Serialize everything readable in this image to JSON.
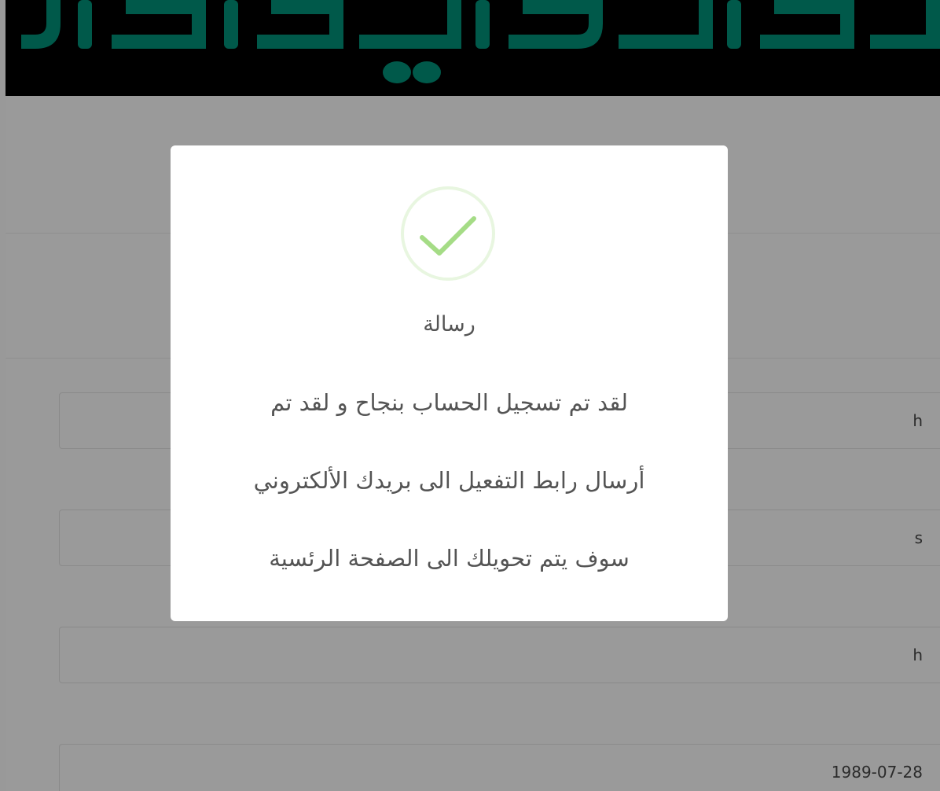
{
  "colors": {
    "overlay": "#999999",
    "header_bg": "#000000",
    "logo_teal": "#00594a",
    "modal_bg": "#ffffff",
    "text": "#545454",
    "success_green": "#a5dc86",
    "success_ring": "#e8f6e0"
  },
  "modal": {
    "icon": "success-check-icon",
    "title": "رسالة",
    "lines": [
      "لقد تم تسجيل الحساب بنجاح و لقد تم",
      "أرسال رابط التفعيل الى بريدك الألكتروني",
      "سوف يتم تحويلك الى الصفحة الرئسية"
    ]
  },
  "form": {
    "fields": [
      {
        "value": "h"
      },
      {
        "value": "s"
      },
      {
        "value": "h"
      },
      {
        "value": "1989-07-28"
      }
    ]
  }
}
